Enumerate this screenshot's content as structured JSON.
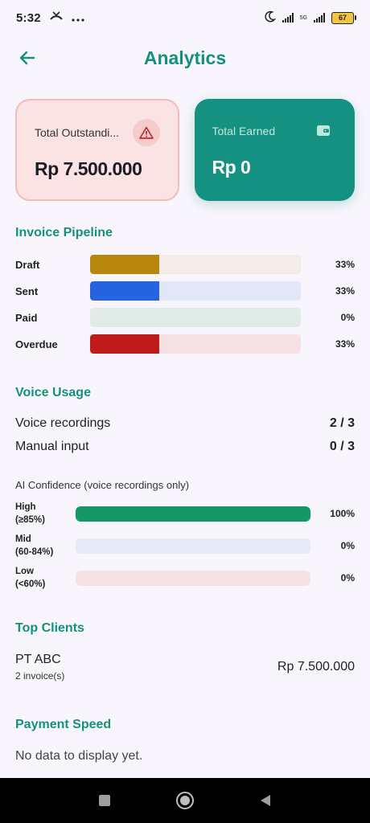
{
  "status_bar": {
    "time": "5:32",
    "network": "5G",
    "battery": "67"
  },
  "header": {
    "title": "Analytics"
  },
  "cards": {
    "outstanding": {
      "label": "Total Outstandi...",
      "value": "Rp 7.500.000"
    },
    "earned": {
      "label": "Total Earned",
      "value": "Rp 0"
    }
  },
  "pipeline": {
    "title": "Invoice Pipeline",
    "rows": [
      {
        "label": "Draft",
        "percent": "33%",
        "fraction": 0.33,
        "color": "#b8860b",
        "track": "#f3ede8"
      },
      {
        "label": "Sent",
        "percent": "33%",
        "fraction": 0.33,
        "color": "#2563e0",
        "track": "#e3e8f8"
      },
      {
        "label": "Paid",
        "percent": "0%",
        "fraction": 0,
        "color": "#149180",
        "track": "#e1ece9"
      },
      {
        "label": "Overdue",
        "percent": "33%",
        "fraction": 0.33,
        "color": "#be1b1b",
        "track": "#f5e1e4"
      }
    ]
  },
  "voice_usage": {
    "title": "Voice Usage",
    "rows": [
      {
        "label": "Voice recordings",
        "value": "2 / 3"
      },
      {
        "label": "Manual input",
        "value": "0 / 3"
      }
    ],
    "confidence_title": "AI Confidence (voice recordings only)",
    "confidence": [
      {
        "label_line1": "High",
        "label_line2": "(≥85%)",
        "percent": "100%",
        "fraction": 1.0,
        "color": "#149668",
        "track": "#e4ecf5"
      },
      {
        "label_line1": "Mid",
        "label_line2": "(60-84%)",
        "percent": "0%",
        "fraction": 0,
        "color": "#2563e0",
        "track": "#e5e9f8"
      },
      {
        "label_line1": "Low",
        "label_line2": "(<60%)",
        "percent": "0%",
        "fraction": 0,
        "color": "#be1b1b",
        "track": "#f5e2e6"
      }
    ]
  },
  "top_clients": {
    "title": "Top Clients",
    "items": [
      {
        "name": "PT ABC",
        "sub": "2 invoice(s)",
        "amount": "Rp 7.500.000"
      }
    ]
  },
  "payment_speed": {
    "title": "Payment Speed",
    "empty": "No data to display yet."
  }
}
